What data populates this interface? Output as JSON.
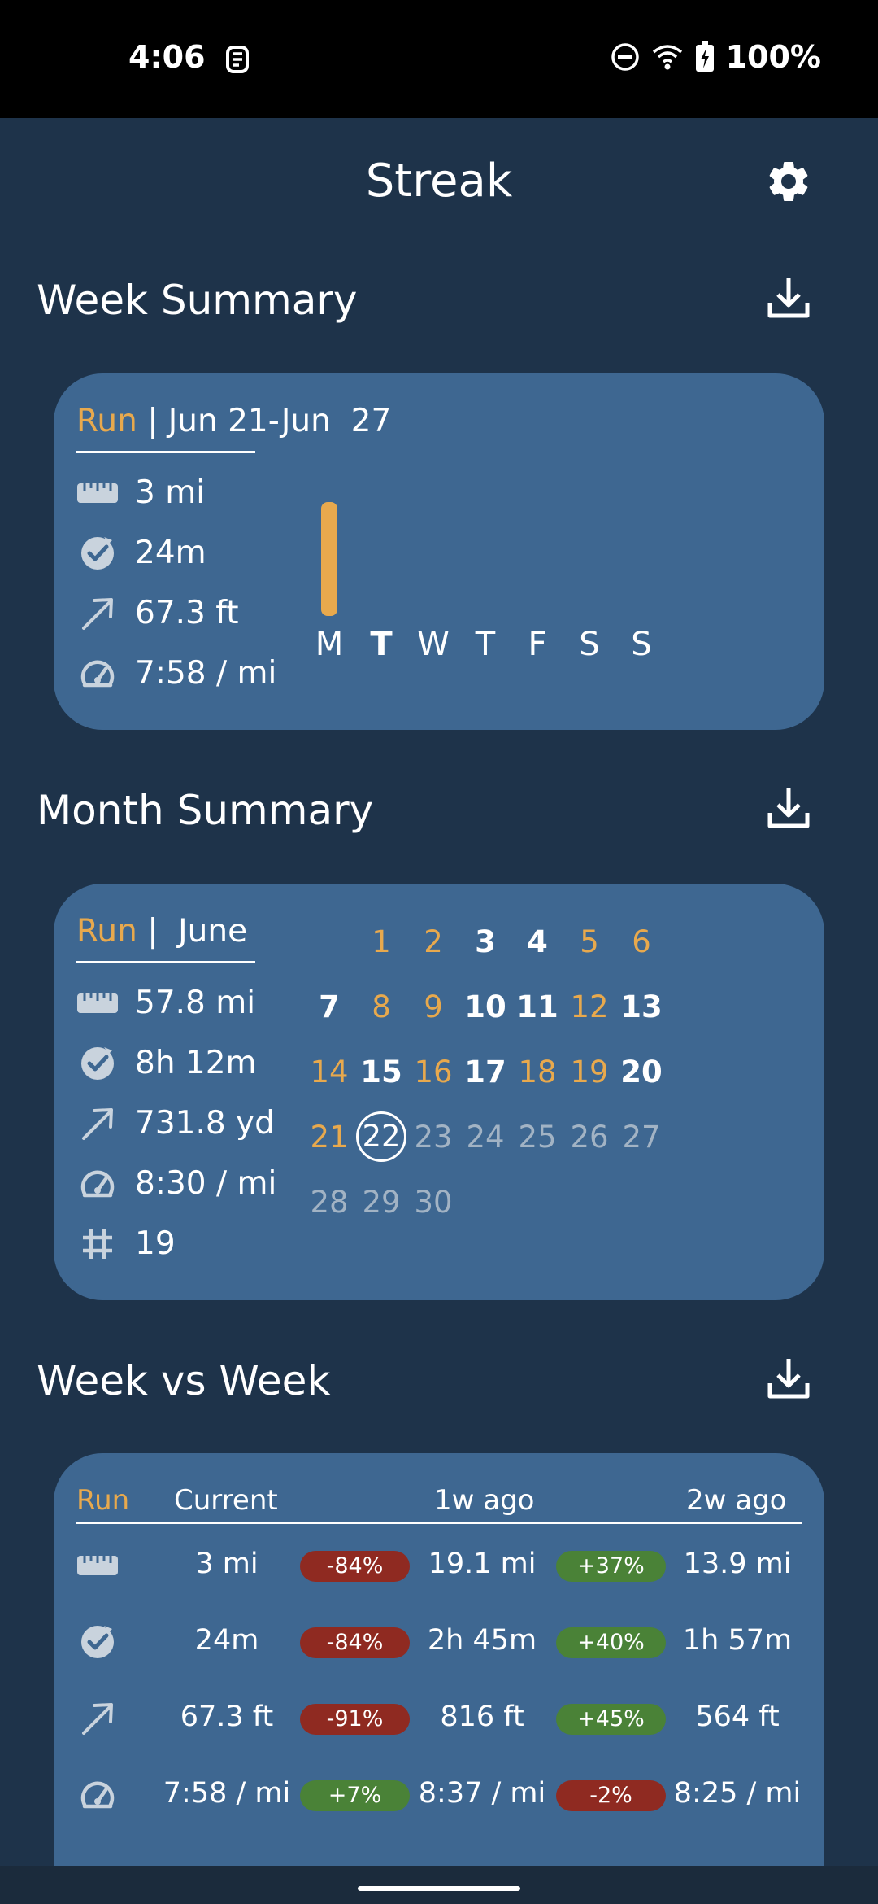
{
  "status_bar": {
    "time": "4:06",
    "battery": "100%"
  },
  "app": {
    "title": "Streak"
  },
  "icons": {
    "distance": "ruler-icon",
    "duration": "clock-check-icon",
    "elevation": "arrow-up-right-icon",
    "pace": "speedometer-icon",
    "count": "hash-icon",
    "settings": "gear-icon",
    "download": "download-icon"
  },
  "colors": {
    "accent": "#e8a94d",
    "card": "#3e6791",
    "background": "#1e334a",
    "decrease": "#8f2a21",
    "increase": "#4a8237"
  },
  "week_summary": {
    "title": "Week Summary",
    "activity": "Run",
    "range": " | Jun 21-Jun  27",
    "stats": {
      "distance": "3 mi",
      "duration": "24m",
      "elevation": "67.3 ft",
      "pace": "7:58 / mi"
    },
    "days": [
      "M",
      "T",
      "W",
      "T",
      "F",
      "S",
      "S"
    ],
    "current_day_index": 1,
    "bars": [
      1,
      0,
      0,
      0,
      0,
      0,
      0
    ]
  },
  "month_summary": {
    "title": "Month Summary",
    "activity": "Run",
    "month": " |  June",
    "stats": {
      "distance": "57.8 mi",
      "duration": "8h 12m",
      "elevation": "731.8 yd",
      "pace": "8:30 / mi",
      "count": "19"
    },
    "calendar": {
      "today": "22",
      "active_days": [
        "1",
        "2",
        "5",
        "6",
        "8",
        "9",
        "12",
        "14",
        "16",
        "18",
        "19",
        "21"
      ],
      "rows": [
        [
          "",
          "",
          "1",
          "2",
          "3",
          "4",
          "5",
          "6"
        ],
        [
          "7",
          "8",
          "9",
          "10",
          "11",
          "12",
          "13"
        ],
        [
          "14",
          "15",
          "16",
          "17",
          "18",
          "19",
          "20"
        ],
        [
          "21",
          "22",
          "23",
          "24",
          "25",
          "26",
          "27"
        ],
        [
          "28",
          "29",
          "30"
        ]
      ]
    }
  },
  "week_vs_week": {
    "title": "Week vs Week",
    "activity": "Run",
    "col_current": "Current",
    "col_1w": "1w ago",
    "col_2w": "2w ago",
    "rows": [
      {
        "current": "3 mi",
        "change1": "-84%",
        "change1_dir": "down",
        "w1": "19.1 mi",
        "change2": "+37%",
        "change2_dir": "up",
        "w2": "13.9 mi"
      },
      {
        "current": "24m",
        "change1": "-84%",
        "change1_dir": "down",
        "w1": "2h 45m",
        "change2": "+40%",
        "change2_dir": "up",
        "w2": "1h 57m"
      },
      {
        "current": "67.3 ft",
        "change1": "-91%",
        "change1_dir": "down",
        "w1": "816 ft",
        "change2": "+45%",
        "change2_dir": "up",
        "w2": "564 ft"
      },
      {
        "current": "7:58 / mi",
        "change1": "+7%",
        "change1_dir": "up",
        "w1": "8:37 / mi",
        "change2": "-2%",
        "change2_dir": "down",
        "w2": "8:25 / mi"
      }
    ]
  }
}
